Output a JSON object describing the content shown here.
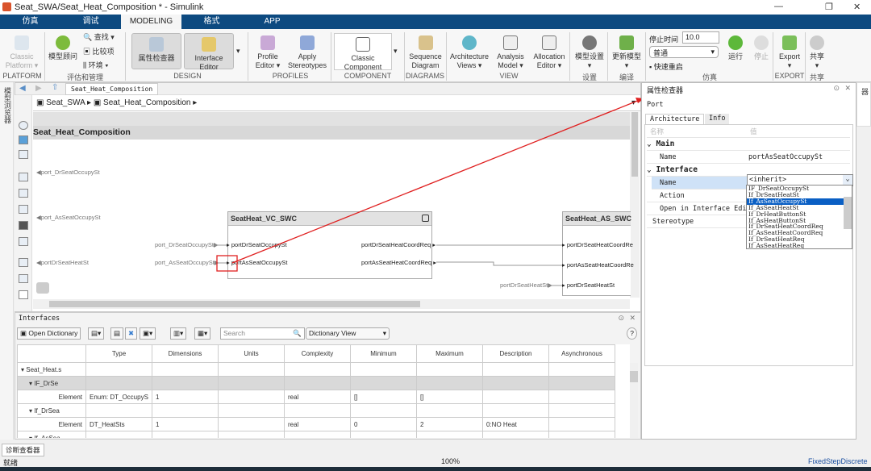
{
  "window": {
    "title": "Seat_SWA/Seat_Heat_Composition * - Simulink",
    "minimize": "—",
    "maximize": "❐",
    "close": "✕"
  },
  "tabs": [
    "仿真",
    "调试",
    "MODELING",
    "格式",
    "APP"
  ],
  "active_tab": "MODELING",
  "quick_access": "▪ ↶ ↷ 🔍 ▾ ? ▾ ⊙",
  "ribbon": {
    "platform": {
      "btn": "Classic Platform ▾",
      "label": "PLATFORM"
    },
    "eval": {
      "advisor": "模型顾问",
      "find": "查找",
      "compare": "比较项",
      "env": "环境",
      "label": "评估和管理"
    },
    "design": {
      "pi": "属性检查器",
      "ie": "Interface Editor",
      "label": "DESIGN"
    },
    "profiles": {
      "pe": "Profile Editor ▾",
      "as": "Apply Stereotypes",
      "label": "PROFILES"
    },
    "component": {
      "cc": "Classic Component",
      "label": "COMPONENT"
    },
    "diagrams": {
      "sd": "Sequence Diagram",
      "label": "DIAGRAMS"
    },
    "view": {
      "av": "Architecture Views ▾",
      "am": "Analysis Model ▾",
      "ae": "Allocation Editor ▾",
      "label": "VIEW"
    },
    "settings": {
      "ms": "模型设置",
      "label": "设置"
    },
    "compile": {
      "um": "更新模型",
      "label": "编译"
    },
    "sim": {
      "stop_time_label": "停止时间",
      "stop_time": "10.0",
      "mode": "普通",
      "fast_restart": "快速重启",
      "run": "运行",
      "stop": "停止",
      "label": "仿真"
    },
    "export": {
      "btn": "Export",
      "label": "EXPORT"
    },
    "share": {
      "btn": "共享",
      "label": "共享"
    }
  },
  "left_strip": "模型浏览器",
  "right_strip": "属性检查器",
  "canvas": {
    "tab": "Seat_Heat_Composition",
    "breadcrumb": [
      "Seat_SWA",
      "Seat_Heat_Composition"
    ],
    "title": "Seat_Heat_Composition",
    "root_ports": [
      "port_DrSeatOccupySt",
      "port_AsSeatOccupySt",
      "portDrSeatHeatSt"
    ],
    "vc_block": {
      "name": "SeatHeat_VC_SWC",
      "in": [
        "portDrSeatOccupySt",
        "portAsSeatOccupySt"
      ],
      "out": [
        "portDrSeatHeatCoordReq",
        "portAsSeatHeatCoordReq"
      ],
      "src": [
        "port_DrSeatOccupySt",
        "port_AsSeatOccupySt"
      ]
    },
    "as_block": {
      "name": "SeatHeat_AS_SWC",
      "in": [
        "portDrSeatHeatCoordRe",
        "portAsSeatHeatCoordRe",
        "portDrSeatHeatSt"
      ],
      "src": "portDrSeatHeatSt"
    }
  },
  "inspector": {
    "title": "属性检查器",
    "element": "Port",
    "tabs": [
      "Architecture",
      "Info"
    ],
    "col_name": "名称",
    "col_value": "值",
    "main": "Main",
    "name_label": "Name",
    "name_value": "portAsSeatOccupySt",
    "interface": "Interface",
    "if_name_label": "Name",
    "if_name_value": "<inherit>",
    "action": "Action",
    "open_ie": "Open in Interface Edi…",
    "stereotype": "Stereotype",
    "dropdown": [
      "IF_DrSeatOccupySt",
      "If_DrSeatHeatSt",
      "If_AsSeatOccupySt",
      "If_AsSeatHeatSt",
      "If_DrHeatButtonSt",
      "If_AsHeatButtonSt",
      "If_DrSeatHeatCoordReq",
      "If_AsSeatHeatCoordReq",
      "If_DrSeatHeatReq",
      "If_AsSeatHeatReq"
    ],
    "selected": "If_AsSeatOccupySt"
  },
  "interfaces": {
    "title": "Interfaces",
    "open_dict": "Open Dictionary",
    "search_placeholder": "Search",
    "view": "Dictionary View",
    "help": "?",
    "columns": [
      "",
      "Type",
      "Dimensions",
      "Units",
      "Complexity",
      "Minimum",
      "Maximum",
      "Description",
      "Asynchronous"
    ],
    "rows": [
      [
        "▾ Seat_Heat.s",
        "",
        "",
        "",
        "",
        "",
        "",
        "",
        ""
      ],
      [
        "▾ IF_DrSe",
        "",
        "",
        "",
        "",
        "",
        "",
        "",
        ""
      ],
      [
        "Element",
        "Enum: DT_OccupyS",
        "1",
        "",
        "real",
        "[]",
        "[]",
        "",
        ""
      ],
      [
        "▾ If_DrSea",
        "",
        "",
        "",
        "",
        "",
        "",
        "",
        ""
      ],
      [
        "Element",
        "DT_HeatSts",
        "1",
        "",
        "real",
        "0",
        "2",
        "0:NO Heat",
        ""
      ],
      [
        "▾ If_AsSea",
        "",
        "",
        "",
        "",
        "",
        "",
        "",
        ""
      ]
    ]
  },
  "status": {
    "diag": "诊断查看器",
    "ready": "就绪",
    "zoom": "100%",
    "solver": "FixedStepDiscrete"
  }
}
